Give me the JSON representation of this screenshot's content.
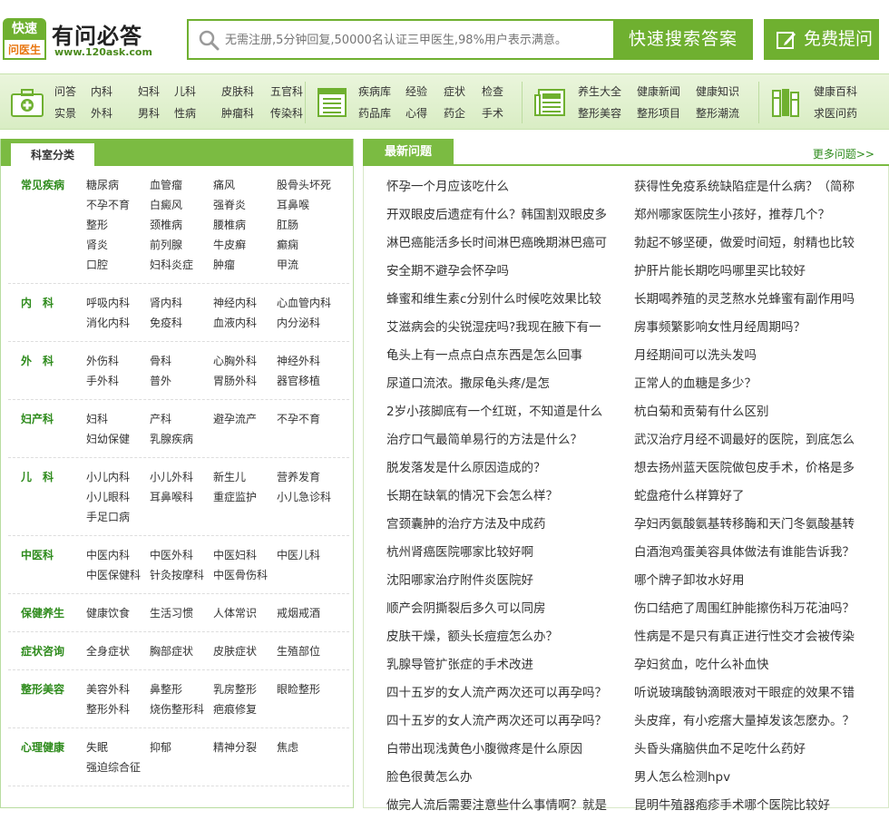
{
  "logo": {
    "badge_top": "快速",
    "badge_bottom": "问医生",
    "title": "有问必答",
    "url": "www.120ask.com"
  },
  "search": {
    "placeholder": "无需注册,5分钟回复,50000名认证三甲医生,98%用户表示满意。",
    "button": "快速搜索答案"
  },
  "ask_button": "免费提问",
  "nav": {
    "group1": [
      "问答",
      "实景",
      "内科",
      "外科",
      "妇科",
      "男科",
      "儿科",
      "性病",
      "皮肤科",
      "肿瘤科",
      "五官科",
      "传染科"
    ],
    "group2": [
      "疾病库",
      "药品库",
      "经验",
      "心得",
      "症状",
      "药企",
      "检查",
      "手术"
    ],
    "group3": [
      "养生大全",
      "整形美容",
      "健康新闻",
      "整形项目",
      "健康知识",
      "整形潮流"
    ],
    "group4": [
      "健康百科",
      "求医问药"
    ]
  },
  "left_panel": {
    "tab": "科室分类",
    "departments": [
      {
        "title": "常见疾病",
        "items": [
          "糖尿病",
          "血管瘤",
          "痛风",
          "股骨头坏死",
          "不孕不育",
          "白癜风",
          "强脊炎",
          "耳鼻喉",
          "整形",
          "颈椎病",
          "腰椎病",
          "肛肠",
          "肾炎",
          "前列腺",
          "牛皮癣",
          "癫痫",
          "口腔",
          "妇科炎症",
          "肿瘤",
          "甲流"
        ]
      },
      {
        "title": "内　科",
        "items": [
          "呼吸内科",
          "肾内科",
          "神经内科",
          "心血管内科",
          "消化内科",
          "免疫科",
          "血液内科",
          "内分泌科"
        ]
      },
      {
        "title": "外　科",
        "items": [
          "外伤科",
          "骨科",
          "心胸外科",
          "神经外科",
          "手外科",
          "普外",
          "胃肠外科",
          "器官移植"
        ]
      },
      {
        "title": "妇产科",
        "items": [
          "妇科",
          "产科",
          "避孕流产",
          "不孕不育",
          "妇幼保健",
          "乳腺疾病"
        ]
      },
      {
        "title": "儿　科",
        "items": [
          "小儿内科",
          "小儿外科",
          "新生儿",
          "营养发育",
          "小儿眼科",
          "耳鼻喉科",
          "重症监护",
          "小儿急诊科",
          "手足口病"
        ]
      },
      {
        "title": "中医科",
        "items": [
          "中医内科",
          "中医外科",
          "中医妇科",
          "中医儿科",
          "中医保健科",
          "针灸按摩科",
          "中医骨伤科"
        ]
      },
      {
        "title": "保健养生",
        "items": [
          "健康饮食",
          "生活习惯",
          "人体常识",
          "戒烟戒酒"
        ]
      },
      {
        "title": "症状咨询",
        "items": [
          "全身症状",
          "胸部症状",
          "皮肤症状",
          "生殖部位"
        ]
      },
      {
        "title": "整形美容",
        "items": [
          "美容外科",
          "鼻整形",
          "乳房整形",
          "眼睑整形",
          "整形外科",
          "烧伤整形科",
          "疤痕修复"
        ]
      },
      {
        "title": "心理健康",
        "items": [
          "失眠",
          "抑郁",
          "精神分裂",
          "焦虑",
          "强迫综合征"
        ]
      }
    ]
  },
  "right_panel": {
    "tab": "最新问题",
    "more": "更多问题>>",
    "questions_left": [
      "怀孕一个月应该吃什么",
      "开双眼皮后遗症有什么？韩国割双眼皮多",
      "淋巴癌能活多长时间淋巴癌晚期淋巴癌可",
      "安全期不避孕会怀孕吗",
      "蜂蜜和维生素c分别什么时候吃效果比较",
      "艾滋病会的尖锐湿疣吗?我现在腋下有一",
      "龟头上有一点点白点东西是怎么回事",
      "尿道口流浓。撒尿龟头疼/是怎",
      "2岁小孩脚底有一个红斑，不知道是什么",
      "治疗口气最简单易行的方法是什么？",
      "脱发落发是什么原因造成的？",
      "长期在缺氧的情况下会怎么样？",
      "宫颈囊肿的治疗方法及中成药",
      "杭州肾癌医院哪家比较好啊",
      "沈阳哪家治疗附件炎医院好",
      "顺产会阴撕裂后多久可以同房",
      "皮肤干燥，额头长痘痘怎么办？",
      "乳腺导管扩张症的手术改进",
      "四十五岁的女人流产两次还可以再孕吗？",
      "四十五岁的女人流产两次还可以再孕吗？",
      "白带出现浅黄色小腹微疼是什么原因",
      "脸色很黄怎么办",
      "做完人流后需要注意些什么事情啊？就是"
    ],
    "questions_right": [
      "获得性免疫系统缺陷症是什么病？（简称",
      "郑州哪家医院生小孩好，推荐几个？",
      "勃起不够坚硬，做爱时间短，射精也比较",
      "护肝片能长期吃吗哪里买比较好",
      "长期喝养殖的灵芝熬水兑蜂蜜有副作用吗",
      "房事频繁影响女性月经周期吗？",
      "月经期间可以洗头发吗",
      "正常人的血糖是多少？",
      "杭白菊和贡菊有什么区别",
      "武汉治疗月经不调最好的医院，到底怎么",
      "想去扬州蓝天医院做包皮手术，价格是多",
      "蛇盘疮什么样算好了",
      "孕妇丙氨酸氨基转移酶和天门冬氨酸基转",
      "白酒泡鸡蛋美容具体做法有谁能告诉我？",
      "哪个牌子卸妆水好用",
      "伤口结疤了周围红肿能擦伤科万花油吗？",
      "性病是不是只有真正进行性交才会被传染",
      "孕妇贫血，吃什么补血快",
      "听说玻璃酸钠滴眼液对干眼症的效果不错",
      "头皮痒，有小疙瘩大量掉发该怎麽办。？",
      "头昏头痛脑供血不足吃什么药好",
      "男人怎么检测hpv",
      "昆明牛殖器疱疹手术哪个医院比较好"
    ]
  },
  "colors": {
    "brand_green": "#6fb030",
    "dept_title": "#2e8b1c",
    "badge_orange": "#e8750e"
  },
  "icons": [
    "search-icon",
    "pen-icon",
    "medical-kit-icon",
    "list-icon",
    "news-icon",
    "books-icon"
  ]
}
